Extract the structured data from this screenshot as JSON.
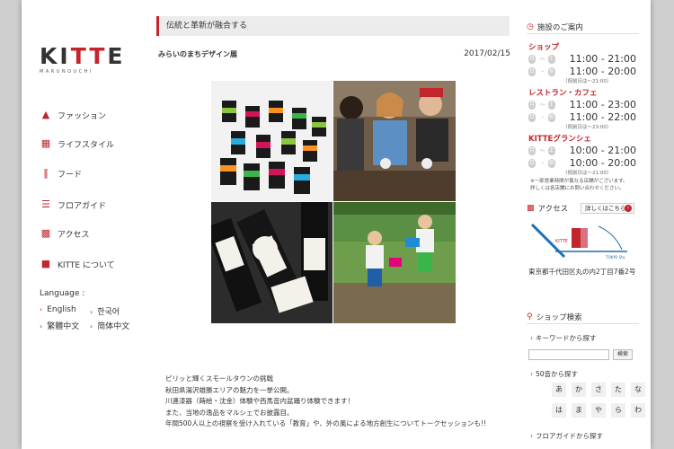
{
  "brand": {
    "logo_word_1": "KI",
    "logo_word_2": "TT",
    "logo_word_3": "E",
    "logo_sub": "MARUNOUCHI",
    "accent": "#c4252d"
  },
  "nav": {
    "items": [
      {
        "label": "ファッション",
        "icon": "dress-icon"
      },
      {
        "label": "ライフスタイル",
        "icon": "chair-icon"
      },
      {
        "label": "フード",
        "icon": "cutlery-icon"
      },
      {
        "label": "フロアガイド",
        "icon": "floor-guide-icon"
      },
      {
        "label": "アクセス",
        "icon": "bus-icon"
      },
      {
        "label": "KITTE について",
        "icon": "kitte-building-icon"
      }
    ]
  },
  "language": {
    "heading": "Language :",
    "options": [
      "English",
      "한국어",
      "繁體中文",
      "简体中文"
    ]
  },
  "article": {
    "section_title": "伝統と革新が融合する",
    "title": "みらいのまちデザイン展",
    "date": "2017/02/15",
    "body": [
      "ピリッと輝くスモールタウンの挑戦",
      "秋田県湯沢雄勝エリアの魅力を一挙公開。",
      "川連漆器（蒔絵・沈金）体験や西馬音内盆踊り体験できます！",
      "また、当地の逸品をマルシェでお披露目。",
      "年間500人以上の視察を受け入れている「教育」や、外の風による地方創生についてトークセッションも!!"
    ]
  },
  "hours": {
    "heading": "施設のご案内",
    "day_marks": [
      "月",
      "土",
      "日",
      "祝"
    ],
    "shop": {
      "label": "ショップ",
      "weekday": "11:00 - 21:00",
      "holiday": "11:00 - 20:00",
      "holiday_note": "（祝前日は～21:00）"
    },
    "restaurant": {
      "label": "レストラン・カフェ",
      "weekday": "11:00 - 23:00",
      "holiday": "11:00 - 22:00",
      "holiday_note": "（祝前日は～23:00）"
    },
    "granche": {
      "label": "KITTEグランシェ",
      "weekday": "10:00 - 21:00",
      "holiday": "10:00 - 20:00",
      "holiday_note": "（祝前日は～21:00）"
    },
    "notes": [
      "※一部営業時間が異なる店舗がございます。",
      "詳しくは各店舗にお問い合わせください。"
    ]
  },
  "access": {
    "heading": "アクセス",
    "button": "詳しくはこちら",
    "map_label_kitte": "KITTE",
    "map_label_station": "TOKYO Sta.",
    "address": "東京都千代田区丸の内2丁目7番2号"
  },
  "search": {
    "heading": "ショップ検索",
    "keyword_label": "キーワードから探す",
    "keyword_value": "",
    "button": "検索",
    "kana_label": "50音から探す",
    "kana": [
      "あ",
      "か",
      "さ",
      "た",
      "な",
      "は",
      "ま",
      "や",
      "ら",
      "わ"
    ],
    "floor_label": "フロアガイドから探す"
  }
}
